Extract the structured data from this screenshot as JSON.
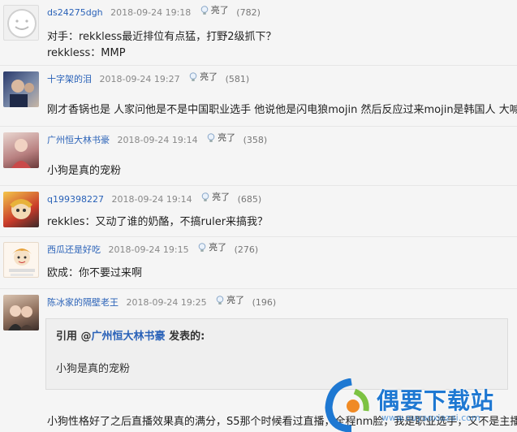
{
  "comments": [
    {
      "user": "ds24275dgh",
      "time": "2018-09-24 19:18",
      "like_label": "亮了",
      "count": "(782)",
      "lines": [
        "对手：rekkless最近排位有点猛，打野2级抓下？",
        "rekkless：MMP"
      ]
    },
    {
      "user": "十字架的泪",
      "time": "2018-09-24 19:27",
      "like_label": "亮了",
      "count": "(581)",
      "lines": [
        "刚才香锅也是 人家问他是不是中国职业选手 他说他是闪电狼mojin 然后反应过来mojin是韩国人 大喊装"
      ]
    },
    {
      "user": "广州恒大林书豪",
      "time": "2018-09-24 19:14",
      "like_label": "亮了",
      "count": "(358)",
      "lines": [
        "小狗是真的宠粉"
      ]
    },
    {
      "user": "q199398227",
      "time": "2018-09-24 19:14",
      "like_label": "亮了",
      "count": "(685)",
      "lines": [
        "rekkles：又动了谁的奶酪，不搞ruler来搞我？"
      ]
    },
    {
      "user": "西瓜还是好吃",
      "time": "2018-09-24 19:15",
      "like_label": "亮了",
      "count": "(276)",
      "lines": [
        "欧成：你不要过来啊"
      ]
    },
    {
      "user": "陈冰家的隔壁老王",
      "time": "2018-09-24 19:25",
      "like_label": "亮了",
      "count": "(196)",
      "lines": [
        "小狗性格好了之后直播效果真的满分，S5那个时候看过直播，全程nm脸，我是职业选手，又不是主播，"
      ]
    }
  ],
  "quote": {
    "prefix": "引用 @",
    "user": "广州恒大林书豪",
    "suffix": " 发表的:",
    "body": "小狗是真的宠粉"
  },
  "watermark": {
    "text": "偶要下载站",
    "url": "www.ouyaoxiazai.com"
  },
  "colors": {
    "username": "#2a62b8",
    "background": "#f5f5f5",
    "watermark": "#1e78d2"
  }
}
